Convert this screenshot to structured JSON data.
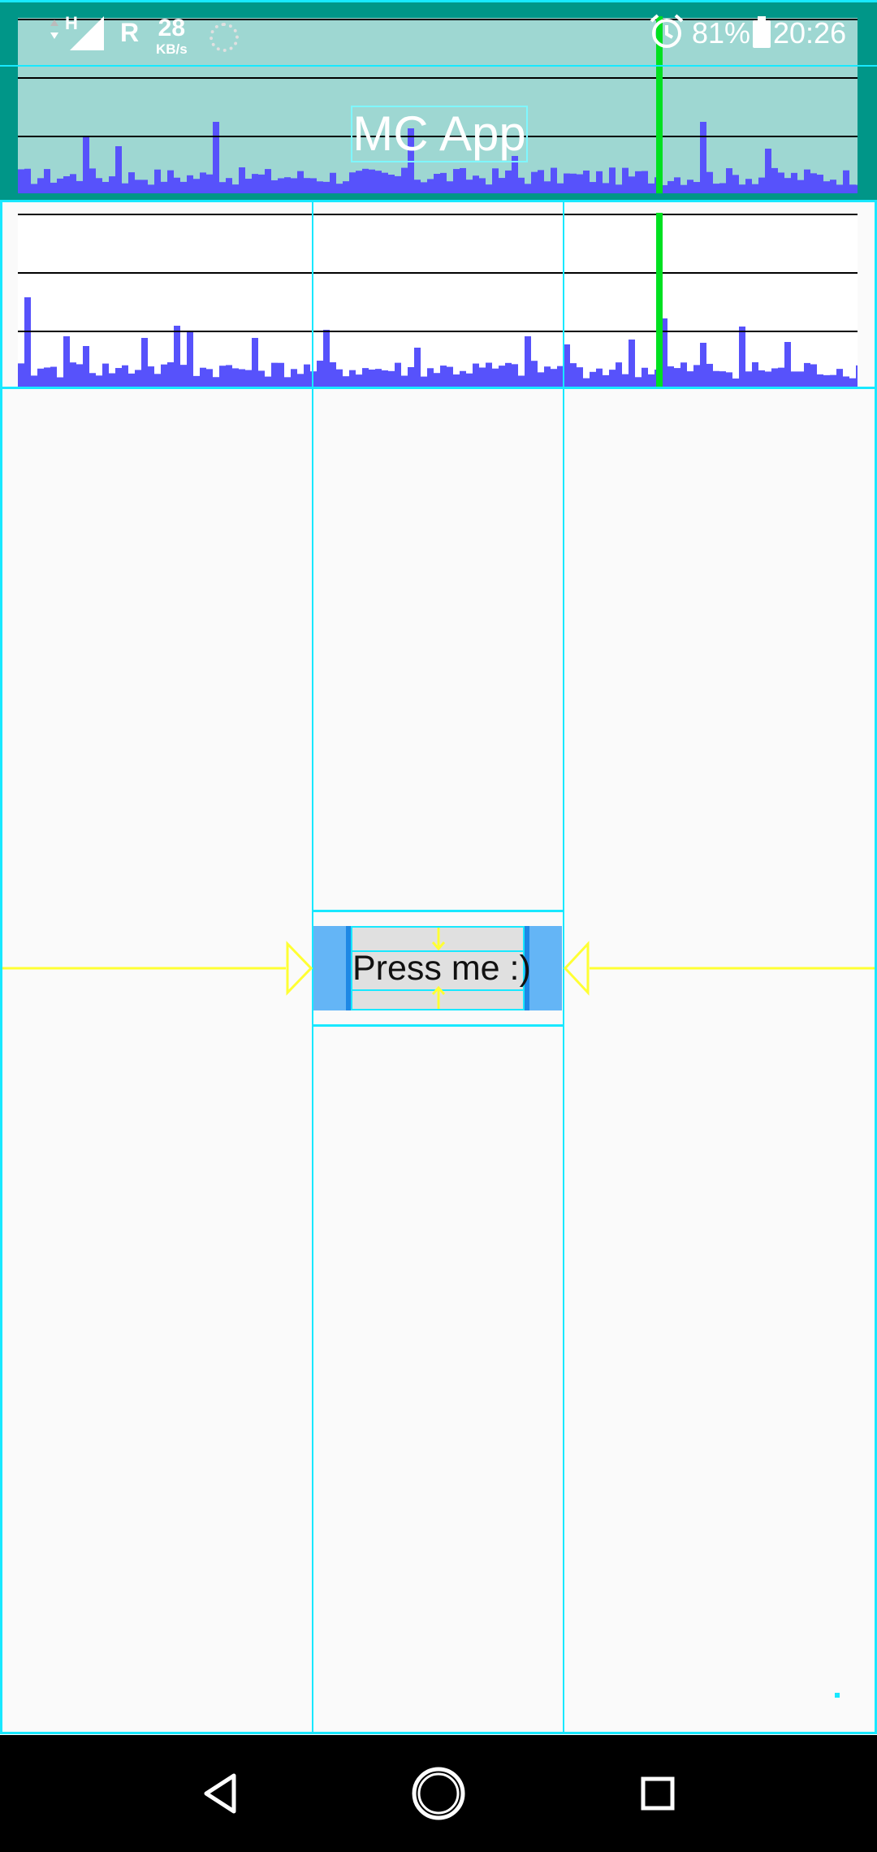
{
  "status_bar": {
    "network_type": "H",
    "roaming": "R",
    "speed_value": "28",
    "speed_unit": "KB/s",
    "battery": "81%",
    "time": "20:26",
    "icons": [
      "signal-icon",
      "sync-icon",
      "alarm-icon",
      "battery-charging-icon"
    ]
  },
  "app_bar": {
    "title": "MC App",
    "background_color": "#009688"
  },
  "profiler": {
    "bar_color": "#5752fb",
    "marker_color": "#00e020"
  },
  "main": {
    "button_label": "Press me :)"
  },
  "nav_bar": {
    "icons": [
      "back-icon",
      "home-icon",
      "recents-icon"
    ]
  },
  "colors": {
    "layout_bounds": "#18e8ff",
    "constraint": "#ffff33",
    "button_bg": "#e0e0e0",
    "button_margin": "#64b5f6"
  }
}
